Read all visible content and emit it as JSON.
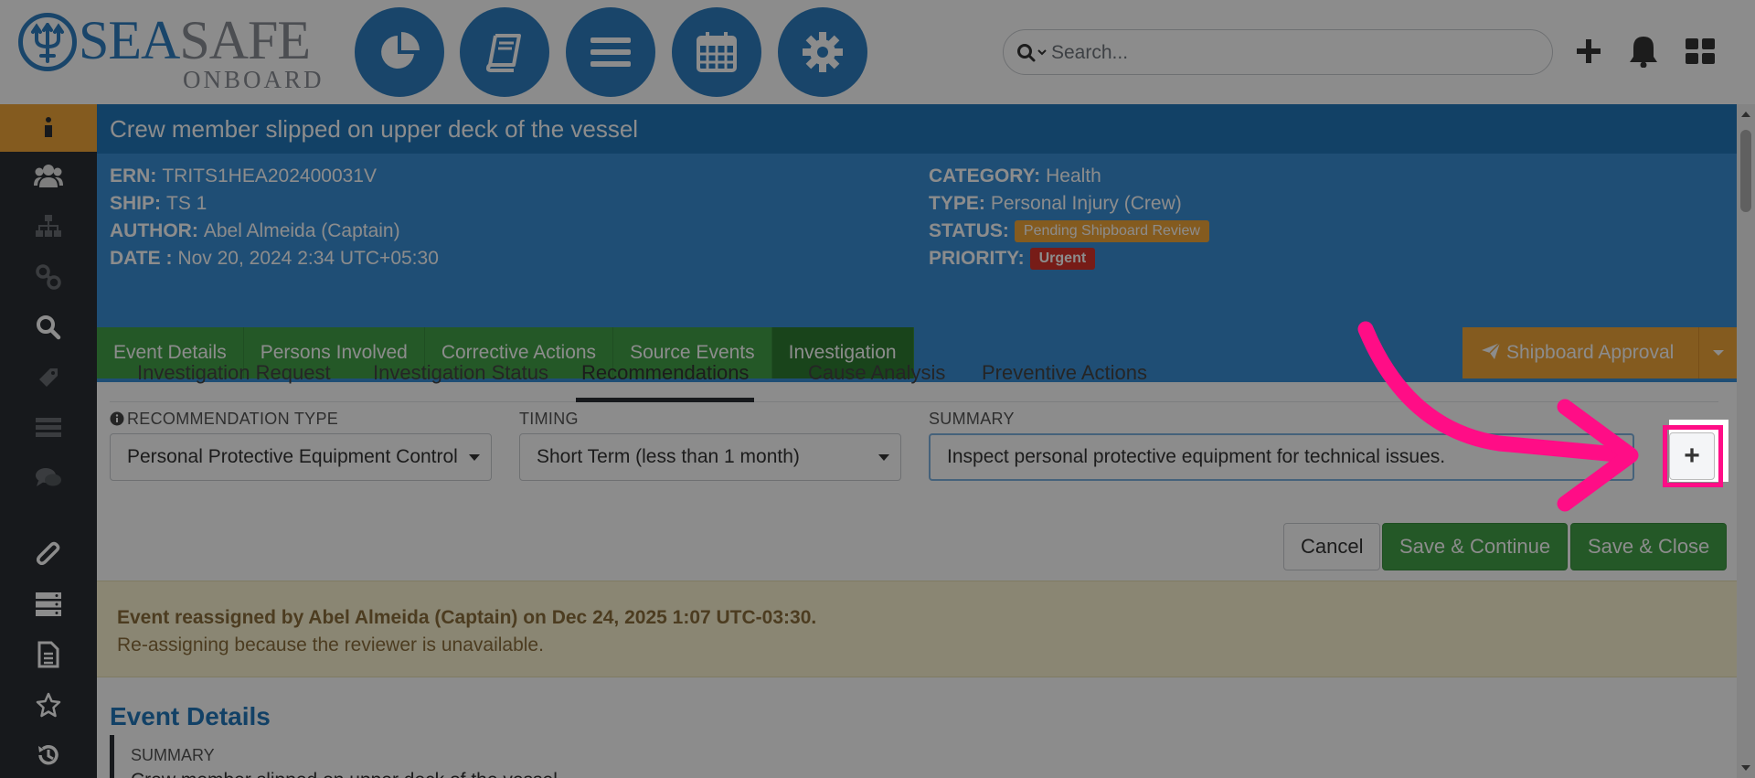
{
  "brand": {
    "word_a": "SEA",
    "word_b": "SAFE",
    "sub": "ONBOARD"
  },
  "topnav": {
    "icons": [
      "dashboard-pie-icon",
      "logbook-icon",
      "menu-icon",
      "calendar-icon",
      "settings-gear-icon"
    ],
    "search_placeholder": "Search...",
    "right_icons": [
      "add-plus-icon",
      "notifications-bell-icon",
      "apps-grid-icon"
    ]
  },
  "sidebar": {
    "items": [
      "info-icon",
      "users-icon",
      "hierarchy-icon",
      "link-icon",
      "search-icon",
      "tag-icon",
      "list-icon",
      "comments-icon",
      "attachment-icon",
      "server-icon",
      "document-icon",
      "star-icon",
      "history-icon"
    ]
  },
  "event": {
    "title": "Crew member slipped on upper deck of the vessel",
    "left": [
      {
        "label": "ERN:",
        "value": "TRITS1HEA202400031V"
      },
      {
        "label": "SHIP:",
        "value": "TS 1"
      },
      {
        "label": "AUTHOR:",
        "value": "Abel Almeida (Captain)"
      },
      {
        "label": "DATE :",
        "value": "Nov 20, 2024 2:34 UTC+05:30"
      }
    ],
    "right": {
      "category_label": "CATEGORY:",
      "category": "Health",
      "type_label": "TYPE:",
      "type": "Personal Injury (Crew)",
      "status_label": "STATUS:",
      "status": "Pending Shipboard Review",
      "priority_label": "PRIORITY:",
      "priority": "Urgent"
    },
    "colors": {
      "header": "#2277bb",
      "info": "#3a8fd6",
      "tab_green": "#43a047",
      "approval": "#f0a63a",
      "urgent": "#d9342b"
    }
  },
  "tabs": [
    "Event Details",
    "Persons Involved",
    "Corrective Actions",
    "Source Events",
    "Investigation"
  ],
  "active_tab": "Investigation",
  "approval": {
    "label": "Shipboard Approval"
  },
  "subtabs": [
    "Investigation Request",
    "Investigation Status",
    "Recommendations",
    "Cause Analysis",
    "Preventive Actions"
  ],
  "active_subtab": "Recommendations",
  "form": {
    "rec_type_label": "RECOMMENDATION TYPE",
    "rec_type_value": "Personal Protective Equipment Control",
    "timing_label": "TIMING",
    "timing_value": "Short Term (less than 1 month)",
    "summary_label": "SUMMARY",
    "summary_value": "Inspect personal protective equipment for technical issues.",
    "add_label": "+",
    "cancel": "Cancel",
    "save_continue": "Save & Continue",
    "save_close": "Save & Close"
  },
  "alert": {
    "line1": "Event reassigned by Abel Almeida (Captain) on Dec 24, 2025 1:07 UTC-03:30.",
    "line2": "Re-assigning because the reviewer is unavailable."
  },
  "details": {
    "title": "Event Details",
    "summary_label": "SUMMARY",
    "summary_value": "Crew member slipped on upper deck of the vessel"
  },
  "annotation_color": "#ff0d86"
}
